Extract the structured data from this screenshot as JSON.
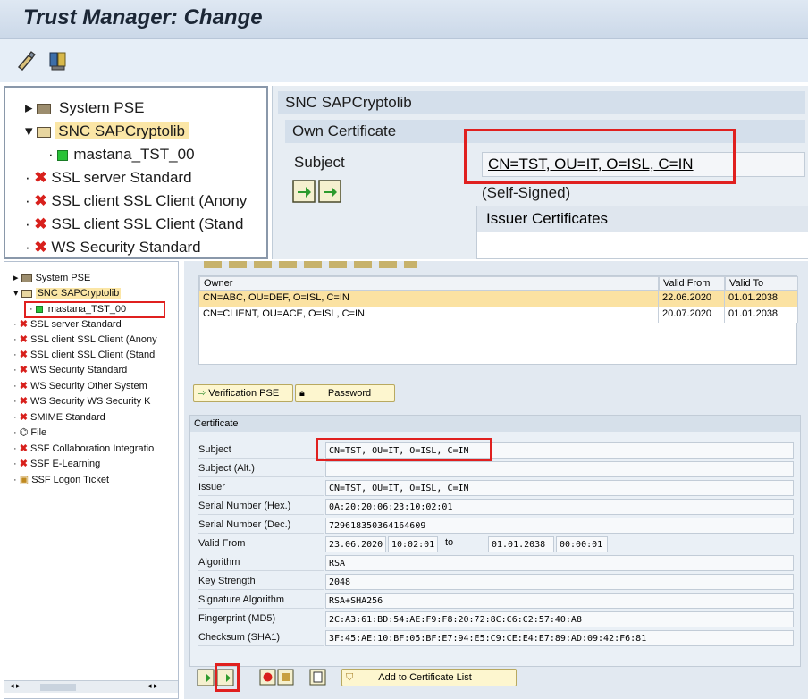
{
  "window": {
    "title": "Trust Manager: Change"
  },
  "toolbar": {
    "icons": [
      "edit-icon",
      "certificate-icon"
    ]
  },
  "big_tree": {
    "items": [
      {
        "label": "System PSE",
        "icon": "folder-icon"
      },
      {
        "label": "SNC SAPCryptolib",
        "icon": "folder-open-icon"
      },
      {
        "label": "mastana_TST_00",
        "icon": "green-square-icon"
      },
      {
        "label": "SSL server Standard",
        "icon": "x-icon"
      },
      {
        "label": "SSL client SSL Client (Anony",
        "icon": "x-icon"
      },
      {
        "label": "SSL client SSL Client (Stand",
        "icon": "x-icon"
      },
      {
        "label": "WS Security Standard",
        "icon": "x-icon"
      }
    ]
  },
  "top_pane": {
    "header": "SNC SAPCryptolib",
    "section": "Own Certificate",
    "subject_label": "Subject",
    "subject_value": "CN=TST, OU=IT, O=ISL, C=IN",
    "self_signed": "(Self-Signed)",
    "issuer_header": "Issuer Certificates"
  },
  "small_tree": {
    "items": [
      {
        "label": "System PSE",
        "icon": "folder-icon"
      },
      {
        "label": "SNC SAPCryptolib",
        "icon": "folder-open-icon"
      },
      {
        "label": "mastana_TST_00",
        "icon": "green-square-icon"
      },
      {
        "label": "SSL server Standard",
        "icon": "x-icon"
      },
      {
        "label": "SSL client SSL Client (Anony",
        "icon": "x-icon"
      },
      {
        "label": "SSL client SSL Client (Stand",
        "icon": "x-icon"
      },
      {
        "label": "WS Security Standard",
        "icon": "x-icon"
      },
      {
        "label": "WS Security Other System",
        "icon": "x-icon"
      },
      {
        "label": "WS Security WS Security K",
        "icon": "x-icon"
      },
      {
        "label": "SMIME Standard",
        "icon": "x-icon"
      },
      {
        "label": "File",
        "icon": "file-icon"
      },
      {
        "label": "SSF Collaboration Integratio",
        "icon": "x-icon"
      },
      {
        "label": "SSF E-Learning",
        "icon": "x-icon"
      },
      {
        "label": "SSF Logon Ticket",
        "icon": "ticket-icon"
      }
    ]
  },
  "cert_list": {
    "columns": [
      "Owner",
      "Valid From",
      "Valid To"
    ],
    "rows": [
      {
        "owner": "CN=ABC, OU=DEF, O=ISL, C=IN",
        "valid_from": "22.06.2020",
        "valid_to": "01.01.2038"
      },
      {
        "owner": "CN=CLIENT, OU=ACE, O=ISL, C=IN",
        "valid_from": "20.07.2020",
        "valid_to": "01.01.2038"
      }
    ]
  },
  "buttons": {
    "verification_pse": "Verification PSE",
    "password": "Password",
    "add_to_cert_list": "Add to Certificate List"
  },
  "certificate": {
    "section_title": "Certificate",
    "fields": [
      {
        "label": "Subject",
        "value": "CN=TST, OU=IT, O=ISL, C=IN"
      },
      {
        "label": "Subject (Alt.)",
        "value": ""
      },
      {
        "label": "Issuer",
        "value": "CN=TST, OU=IT, O=ISL, C=IN"
      },
      {
        "label": "Serial Number (Hex.)",
        "value": "0A:20:20:06:23:10:02:01"
      },
      {
        "label": "Serial Number (Dec.)",
        "value": "729618350364164609"
      },
      {
        "label": "Valid From",
        "value": "23.06.2020"
      },
      {
        "label": "Algorithm",
        "value": "RSA"
      },
      {
        "label": "Key Strength",
        "value": "2048"
      },
      {
        "label": "Signature Algorithm",
        "value": "RSA+SHA256"
      },
      {
        "label": "Fingerprint (MD5)",
        "value": "2C:A3:61:BD:54:AE:F9:F8:20:72:8C:C6:C2:57:40:A8"
      },
      {
        "label": "Checksum (SHA1)",
        "value": "3F:45:AE:10:BF:05:BF:E7:94:E5:C9:CE:E4:E7:89:AD:09:42:F6:81"
      }
    ],
    "valid_from_time": "10:02:01",
    "to_label": "to",
    "valid_to_date": "01.01.2038",
    "valid_to_time": "00:00:01"
  }
}
